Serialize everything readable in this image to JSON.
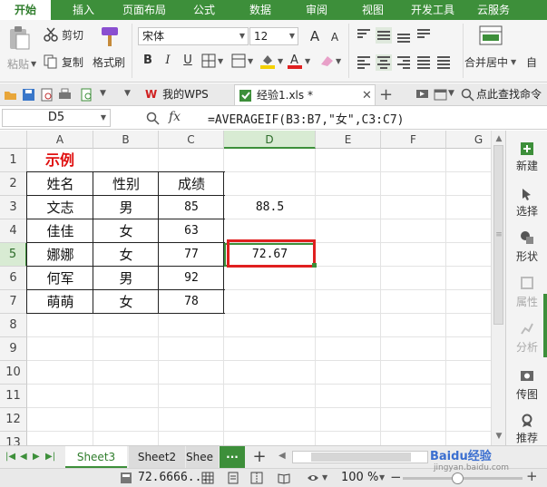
{
  "ribbon_tabs": [
    "开始",
    "插入",
    "页面布局",
    "公式",
    "数据",
    "审阅",
    "视图",
    "开发工具",
    "云服务"
  ],
  "ribbon": {
    "paste": "粘贴",
    "cut": "剪切",
    "copy": "复制",
    "format_painter": "格式刷",
    "font_name": "宋体",
    "font_size": "12",
    "bold": "B",
    "italic": "I",
    "underline": "U",
    "increase_font": "A",
    "decrease_font": "A",
    "merge_center": "合并居中",
    "auto": "自"
  },
  "doc_tabs": {
    "wps_tab": "我的WPS",
    "file_tab": "经验1.xls *",
    "add_tab": "+",
    "search": "点此查找命令"
  },
  "formula_bar": {
    "name_box": "D5",
    "fx": "fx",
    "formula": "=AVERAGEIF(B3:B7,\"女\",C3:C7)"
  },
  "grid": {
    "columns": [
      "A",
      "B",
      "C",
      "D",
      "E",
      "F",
      "G"
    ],
    "rows": [
      "1",
      "2",
      "3",
      "4",
      "5",
      "6",
      "7",
      "8",
      "9",
      "10",
      "11",
      "12",
      "13"
    ],
    "title": "示例",
    "header": [
      "姓名",
      "性别",
      "成绩"
    ],
    "data": [
      [
        "文志",
        "男",
        "85"
      ],
      [
        "佳佳",
        "女",
        "63"
      ],
      [
        "娜娜",
        "女",
        "77"
      ],
      [
        "何军",
        "男",
        "92"
      ],
      [
        "萌萌",
        "女",
        "78"
      ]
    ],
    "d3": "88.5",
    "d5": "72.67",
    "title_color": "#e01010",
    "highlight_color": "#e02020"
  },
  "task_pane": [
    "新建",
    "选择",
    "形状",
    "属性",
    "分析",
    "传图",
    "推荐"
  ],
  "sheets": {
    "tabs": [
      "Sheet3",
      "Sheet2",
      "Shee"
    ],
    "more": "···",
    "add": "+"
  },
  "status": {
    "value": "72.6666...",
    "zoom": "100 %",
    "minus": "−",
    "plus": "+"
  },
  "watermark": {
    "text": "Baidu经验",
    "url": "jingyan.baidu.com"
  },
  "colors": {
    "accent": "#3d8f3a",
    "selection": "#d8ebd3"
  }
}
